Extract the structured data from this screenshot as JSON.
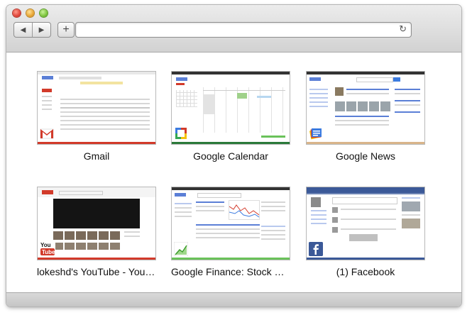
{
  "browser": {
    "url_value": "",
    "back_glyph": "◀",
    "forward_glyph": "▶",
    "add_glyph": "+",
    "reload_glyph": "↻"
  },
  "tiles": [
    {
      "title": "Gmail",
      "accent": "#d23a2a",
      "icon": "gmail-icon"
    },
    {
      "title": "Google Calendar",
      "accent": "#2b7a3a",
      "icon": "google-calendar-icon"
    },
    {
      "title": "Google News",
      "accent": "#d9b58a",
      "icon": "google-news-icon"
    },
    {
      "title": "lokeshd's YouTube - YouTube",
      "accent": "#d23a2a",
      "icon": "youtube-icon",
      "badge_text": "YouTube"
    },
    {
      "title": "Google Finance: Stock Market Quotes, News, Currency Conversions & More",
      "accent": "#6ac25a",
      "icon": "google-finance-icon"
    },
    {
      "title": "(1) Facebook",
      "accent": "#3b5998",
      "icon": "facebook-icon",
      "badge_text": "f"
    }
  ]
}
